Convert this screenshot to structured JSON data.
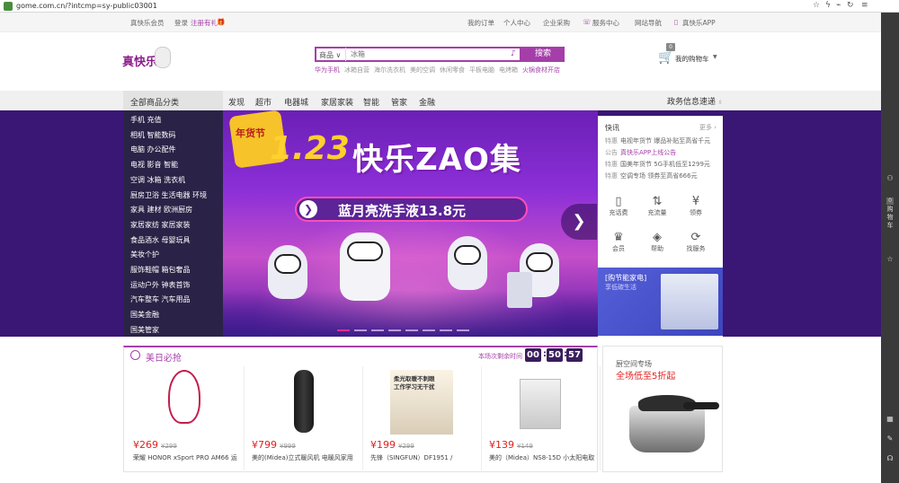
{
  "browser": {
    "url": "gome.com.cn/?intcmp=sy-public03001"
  },
  "topbar": {
    "brand_member": "真快乐会员",
    "login": "登录",
    "register": "注册有礼",
    "my_orders": "我的订单",
    "personal_center": "个人中心",
    "enterprise": "企业采购",
    "service_center": "服务中心",
    "site_nav": "网站导航",
    "app": "真快乐APP"
  },
  "header": {
    "logo": "真快乐",
    "search_category": "商品",
    "search_placeholder": "冰箱",
    "search_button": "搜索",
    "hot_words": [
      "华为手机",
      "冰箱自营",
      "海尔洗衣机",
      "美的空调",
      "休闲零食",
      "平板电脑",
      "电烤箱",
      "火锅食材开店"
    ],
    "cart_label": "我的购物车",
    "cart_count": "0"
  },
  "nav": {
    "all_categories": "全部商品分类",
    "items": [
      "发现",
      "超市",
      "电器城",
      "家居家装",
      "智能",
      "管家",
      "金融"
    ],
    "gov_info": "政务信息速递"
  },
  "categories": [
    "手机 充值",
    "相机 智能数码",
    "电脑 办公配件",
    "电视 影音 智能",
    "空调 冰箱 洗衣机",
    "厨房卫浴 生活电器 环境",
    "家具 建材 欧洲厨房",
    "家居家纺 家居家装",
    "食品酒水 母婴玩具",
    "美妆个护",
    "服饰鞋帽 箱包奢品",
    "运动户外 钟表首饰",
    "汽车整车 汽车用品",
    "国美金融",
    "国美管家"
  ],
  "hero": {
    "badge": "年货节",
    "date": "1.23",
    "title": "快乐ZAO集",
    "subtitle": "蓝月亮洗手液13.8元"
  },
  "news": {
    "title": "快讯",
    "more": "更多",
    "items": [
      {
        "tag": "特惠",
        "text": "电视年货节 爆品补贴至高省千元"
      },
      {
        "tag": "公告",
        "text": "真快乐APP上线公告"
      },
      {
        "tag": "特惠",
        "text": "国美年货节 5G手机低至1299元"
      },
      {
        "tag": "特惠",
        "text": "空调专场 领券至高省666元"
      }
    ]
  },
  "services": [
    {
      "label": "充话费",
      "icon": "phone-icon"
    },
    {
      "label": "充流量",
      "icon": "data-flow-icon"
    },
    {
      "label": "领券",
      "icon": "coupon-icon"
    },
    {
      "label": "会员",
      "icon": "crown-icon"
    },
    {
      "label": "帮助",
      "icon": "help-icon"
    },
    {
      "label": "找服务",
      "icon": "service-icon"
    }
  ],
  "promo": {
    "line1": "[购节能家电]",
    "line2": "享低碳生活"
  },
  "deals": {
    "title": "美日必抢",
    "countdown_label": "本场次剩余时间",
    "countdown": [
      "00",
      "50",
      "57"
    ],
    "products": [
      {
        "price": "¥269",
        "old_price": "¥299",
        "name": "荣耀 HONOR xSport PRO AM66 运"
      },
      {
        "price": "¥799",
        "old_price": "¥999",
        "name": "美的(Midea)立式暖风机 电暖风家用"
      },
      {
        "price": "¥199",
        "old_price": "¥299",
        "name": "先锋（SINGFUN）DF1951 /",
        "img_text1": "柔光取暖不刺眼",
        "img_text2": "工作学习无干扰"
      },
      {
        "price": "¥139",
        "old_price": "¥149",
        "name": "美的（Midea）NS8-15D 小太阳电取"
      }
    ]
  },
  "kitchen": {
    "line1": "厨空间专场",
    "line2": "全场低至5折起"
  },
  "sidebar": {
    "cart": "购物车",
    "cart_count": "0"
  }
}
